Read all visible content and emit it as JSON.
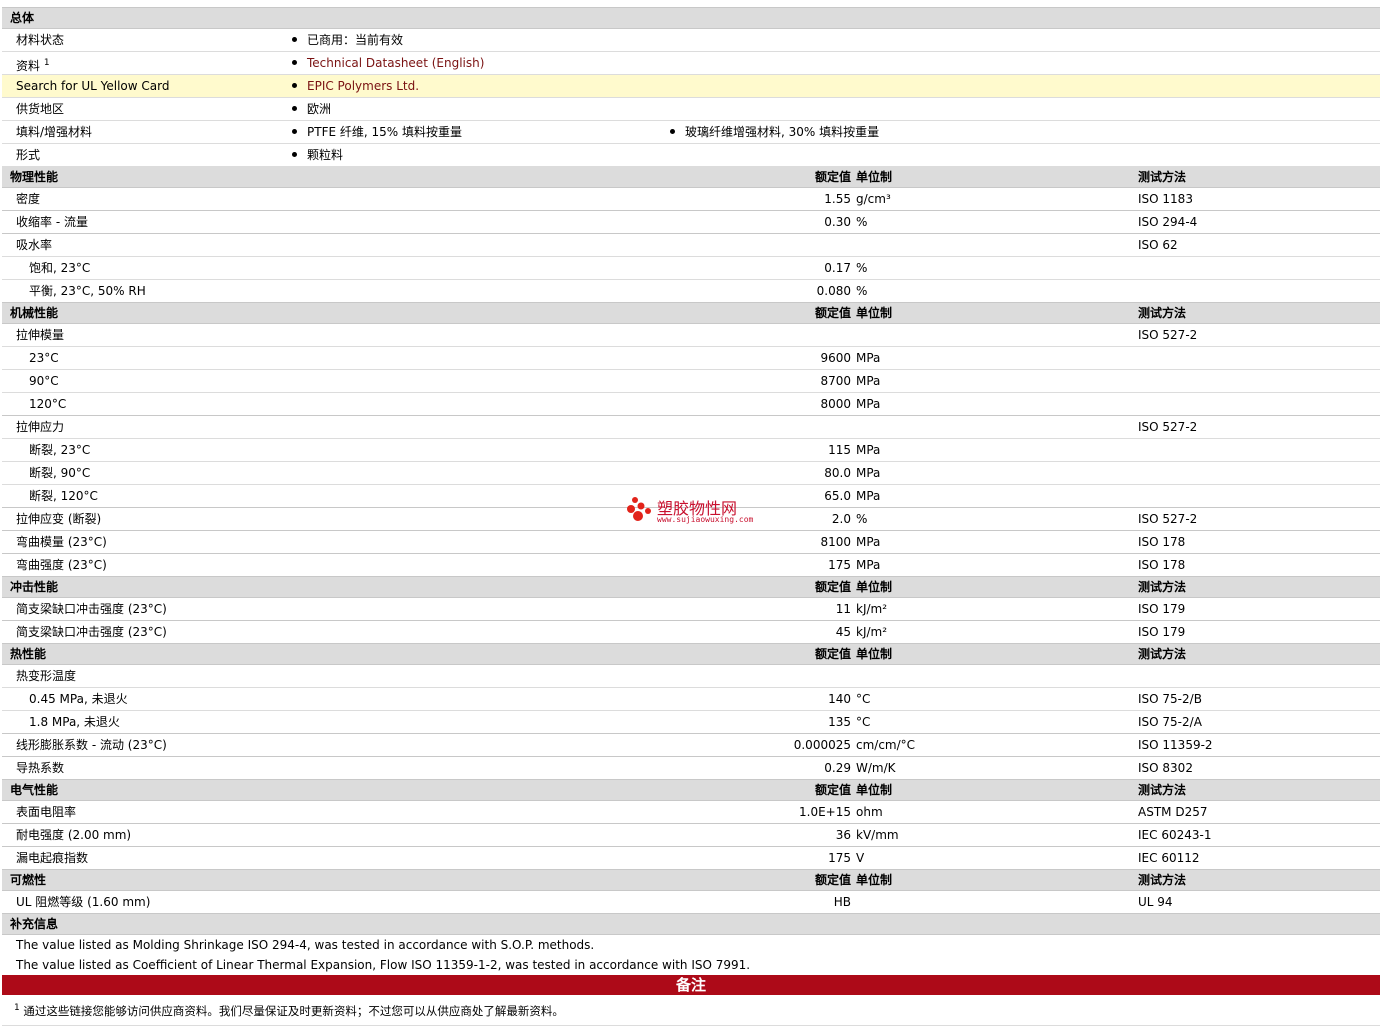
{
  "colors": {
    "section_bg": "#dcdcdc",
    "highlight_bg": "#fffacd",
    "banner_bg": "#ad0a18",
    "link": "#7a1212",
    "watermark": "#c8102e"
  },
  "headers": {
    "value": "额定值",
    "unit": "单位制",
    "test": "测试方法"
  },
  "general": {
    "title": "总体",
    "rows": [
      {
        "label": "材料状态",
        "items": [
          "已商用：当前有效"
        ]
      },
      {
        "label": "资料",
        "sup": "1",
        "items": [
          "Technical Datasheet (English)"
        ],
        "link": true
      },
      {
        "label": "Search for UL Yellow Card",
        "items": [
          "EPIC Polymers Ltd."
        ],
        "link": true,
        "highlight": true
      },
      {
        "label": "供货地区",
        "items": [
          "欧洲"
        ]
      },
      {
        "label": "填料/增强材料",
        "items": [
          "PTFE 纤维, 15% 填料按重量",
          "玻璃纤维增强材料, 30% 填料按重量"
        ]
      },
      {
        "label": "形式",
        "items": [
          "颗粒料"
        ]
      }
    ]
  },
  "sections": [
    {
      "title": "物理性能",
      "rows": [
        {
          "label": "密度",
          "value": "1.55",
          "unit": "g/cm³",
          "test": "ISO 1183"
        },
        {
          "label": "收缩率 - 流量",
          "value": "0.30",
          "unit": "%",
          "test": "ISO 294-4"
        },
        {
          "label": "吸水率",
          "value": "",
          "unit": "",
          "test": "ISO 62",
          "group": true
        },
        {
          "label": "饱和, 23°C",
          "value": "0.17",
          "unit": "%",
          "test": "",
          "sub": true
        },
        {
          "label": "平衡, 23°C, 50% RH",
          "value": "0.080",
          "unit": "%",
          "test": "",
          "sub": true
        }
      ]
    },
    {
      "title": "机械性能",
      "rows": [
        {
          "label": "拉伸模量",
          "value": "",
          "unit": "",
          "test": "ISO 527-2",
          "group": true
        },
        {
          "label": "23°C",
          "value": "9600",
          "unit": "MPa",
          "test": "",
          "sub": true
        },
        {
          "label": "90°C",
          "value": "8700",
          "unit": "MPa",
          "test": "",
          "sub": true
        },
        {
          "label": "120°C",
          "value": "8000",
          "unit": "MPa",
          "test": "",
          "sub": true
        },
        {
          "label": "拉伸应力",
          "value": "",
          "unit": "",
          "test": "ISO 527-2",
          "group": true
        },
        {
          "label": "断裂, 23°C",
          "value": "115",
          "unit": "MPa",
          "test": "",
          "sub": true
        },
        {
          "label": "断裂, 90°C",
          "value": "80.0",
          "unit": "MPa",
          "test": "",
          "sub": true
        },
        {
          "label": "断裂, 120°C",
          "value": "65.0",
          "unit": "MPa",
          "test": "",
          "sub": true
        },
        {
          "label": "拉伸应变 (断裂)",
          "value": "2.0",
          "unit": "%",
          "test": "ISO 527-2"
        },
        {
          "label": "弯曲模量 (23°C)",
          "value": "8100",
          "unit": "MPa",
          "test": "ISO 178"
        },
        {
          "label": "弯曲强度 (23°C)",
          "value": "175",
          "unit": "MPa",
          "test": "ISO 178"
        }
      ]
    },
    {
      "title": "冲击性能",
      "rows": [
        {
          "label": "简支梁缺口冲击强度 (23°C)",
          "value": "11",
          "unit": "kJ/m²",
          "test": "ISO 179"
        },
        {
          "label": "简支梁缺口冲击强度 (23°C)",
          "value": "45",
          "unit": "kJ/m²",
          "test": "ISO 179"
        }
      ]
    },
    {
      "title": "热性能",
      "rows": [
        {
          "label": "热变形温度",
          "value": "",
          "unit": "",
          "test": "",
          "group": true
        },
        {
          "label": "0.45 MPa, 未退火",
          "value": "140",
          "unit": "°C",
          "test": "ISO 75-2/B",
          "sub": true
        },
        {
          "label": "1.8 MPa, 未退火",
          "value": "135",
          "unit": "°C",
          "test": "ISO 75-2/A",
          "sub": true
        },
        {
          "label": "线形膨胀系数 - 流动 (23°C)",
          "value": "0.000025",
          "unit": "cm/cm/°C",
          "test": "ISO 11359-2"
        },
        {
          "label": "导热系数",
          "value": "0.29",
          "unit": "W/m/K",
          "test": "ISO 8302"
        }
      ]
    },
    {
      "title": "电气性能",
      "rows": [
        {
          "label": "表面电阻率",
          "value": "1.0E+15",
          "unit": "ohm",
          "test": "ASTM D257"
        },
        {
          "label": "耐电强度 (2.00 mm)",
          "value": "36",
          "unit": "kV/mm",
          "test": "IEC 60243-1"
        },
        {
          "label": "漏电起痕指数",
          "value": "175",
          "unit": "V",
          "test": "IEC 60112"
        }
      ]
    },
    {
      "title": "可燃性",
      "rows": [
        {
          "label": "UL 阻燃等级 (1.60 mm)",
          "value": "HB",
          "unit": "",
          "test": "UL 94"
        }
      ]
    }
  ],
  "supplement": {
    "title": "补充信息",
    "lines": [
      "The value listed as Molding Shrinkage ISO 294-4, was tested in accordance with S.O.P. methods.",
      "The value listed as Coefficient of Linear Thermal Expansion, Flow ISO 11359-1-2, was tested in accordance with ISO 7991."
    ]
  },
  "notes": {
    "banner": "备注",
    "footnote_mark": "1",
    "footnote": "通过这些链接您能够访问供应商资料。我们尽量保证及时更新资料；不过您可以从供应商处了解最新资料。"
  },
  "watermark": {
    "text": "塑胶物性网",
    "url": "www.sujiaowuxing.com"
  }
}
